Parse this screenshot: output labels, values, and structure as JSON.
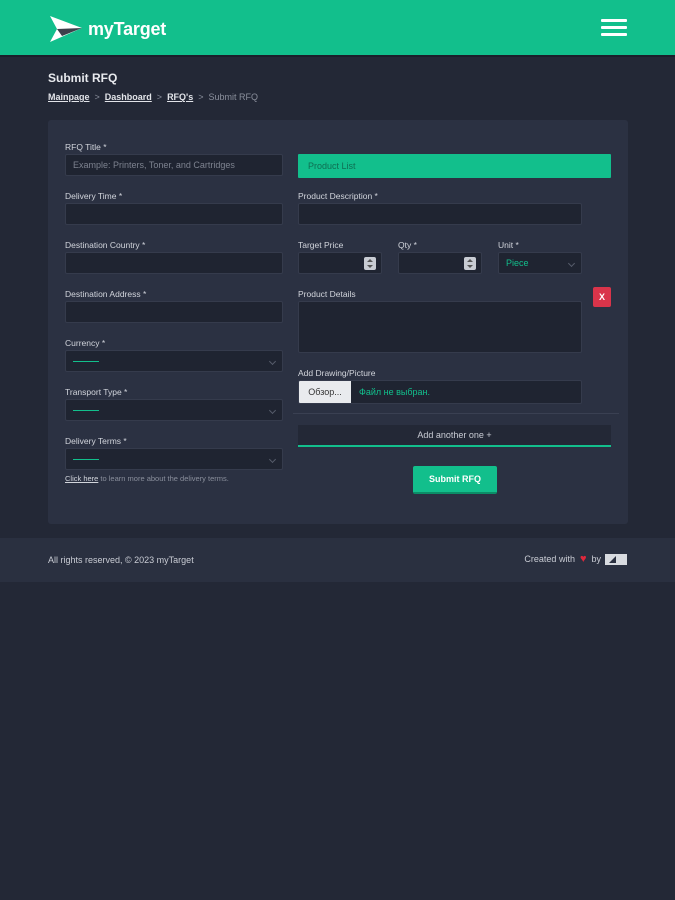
{
  "header": {
    "brand": "myTarget",
    "colors": {
      "accent": "#12bf8c",
      "background": "#232836",
      "danger": "#d9344a"
    }
  },
  "page": {
    "title": "Submit RFQ",
    "breadcrumb": [
      "Mainpage",
      "Dashboard",
      "RFQ's"
    ],
    "breadcrumb_current": "Submit RFQ"
  },
  "form": {
    "rfq_title": {
      "label": "RFQ Title *",
      "placeholder": "Example: Printers, Toner, and Cartridges",
      "value": ""
    },
    "delivery_time": {
      "label": "Delivery Time *",
      "value": ""
    },
    "destination_country": {
      "label": "Destination Country *",
      "value": ""
    },
    "destination_address": {
      "label": "Destination Address *",
      "value": ""
    },
    "currency": {
      "label": "Currency *",
      "value": ""
    },
    "transport_type": {
      "label": "Transport Type *",
      "value": ""
    },
    "delivery_terms": {
      "label": "Delivery Terms *",
      "value": ""
    },
    "help_link": "Click here",
    "help_text": " to learn more about the delivery terms."
  },
  "product": {
    "list_title": "Product List",
    "description_label": "Product Description *",
    "target_price_label": "Target Price",
    "qty_label": "Qty *",
    "unit_label": "Unit *",
    "unit_value": "Piece",
    "details_label": "Product Details",
    "remove_label": "X",
    "drawing_label": "Add Drawing/Picture",
    "file_button": "Обзор...",
    "file_status": "Файл не выбран.",
    "add_another": "Add another one +",
    "submit": "Submit RFQ"
  },
  "footer": {
    "copyright": "All rights reserved, © 2023 myTarget",
    "created_with": "Created with",
    "by": "by"
  },
  "icons": {
    "logo": "paper-plane-logo",
    "menu": "hamburger-icon",
    "heart": "heart-icon"
  }
}
